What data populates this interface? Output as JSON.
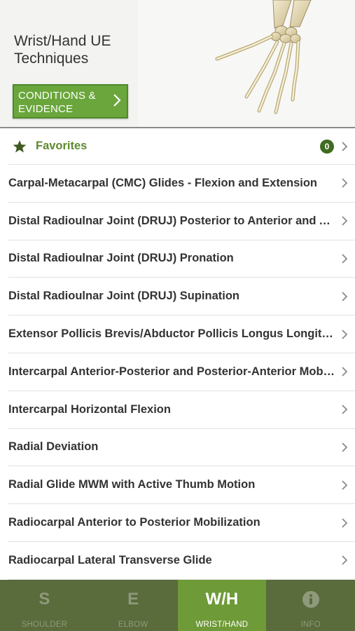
{
  "header": {
    "title_line1": "Wrist/Hand UE",
    "title_line2": "Techniques",
    "conditions_line1": "CONDITIONS &",
    "conditions_line2": "EVIDENCE"
  },
  "favorites": {
    "label": "Favorites",
    "count": "0"
  },
  "items": [
    {
      "label": "Carpal-Metacarpal (CMC) Glides  - Flexion and Extension"
    },
    {
      "label": "Distal Radioulnar Joint (DRUJ) Posterior to Anterior and Anterior to Posterior"
    },
    {
      "label": "Distal Radioulnar Joint (DRUJ) Pronation"
    },
    {
      "label": "Distal Radioulnar Joint (DRUJ) Supination"
    },
    {
      "label": "Extensor Pollicis Brevis/Abductor Pollicis Longus Longitudinal Glide"
    },
    {
      "label": "Intercarpal Anterior-Posterior and Posterior-Anterior Mobilization"
    },
    {
      "label": "Intercarpal Horizontal Flexion"
    },
    {
      "label": "Radial Deviation"
    },
    {
      "label": "Radial Glide MWM with Active Thumb Motion"
    },
    {
      "label": "Radiocarpal Anterior to Posterior Mobilization"
    },
    {
      "label": "Radiocarpal Lateral Transverse Glide"
    }
  ],
  "tabs": [
    {
      "icon": "S",
      "label": "SHOULDER",
      "active": false
    },
    {
      "icon": "E",
      "label": "ELBOW",
      "active": false
    },
    {
      "icon": "W/H",
      "label": "WRIST/HAND",
      "active": true
    },
    {
      "icon": "info-icon",
      "label": "INFO",
      "active": false
    }
  ],
  "colors": {
    "accent_green": "#6aa63b",
    "tabbar_bg": "#5a6b3c",
    "favorites_green": "#5e8a2f"
  }
}
